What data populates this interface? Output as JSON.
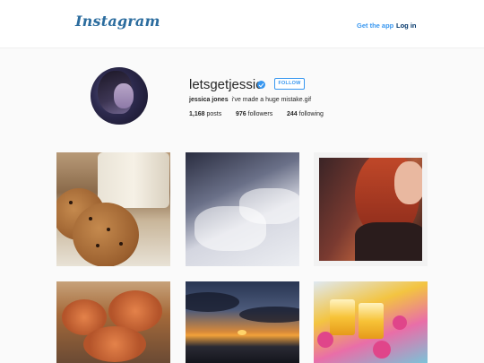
{
  "header": {
    "logo_text": "Instagram",
    "get_app_label": "Get the app",
    "log_in_label": "Log in"
  },
  "profile": {
    "username": "letsgetjessie",
    "verified": true,
    "follow_label": "FOLLOW",
    "full_name": "jessica jones",
    "bio": "i've made a huge mistake.gif",
    "stats": {
      "posts_count": "1,168",
      "posts_label": "posts",
      "followers_count": "976",
      "followers_label": "followers",
      "following_count": "244",
      "following_label": "following"
    }
  },
  "colors": {
    "accent": "#3897f0",
    "logo": "#2b6c9e",
    "text": "#262626",
    "background": "#fafafa"
  },
  "posts": [
    {
      "subject": "cookies-and-milk"
    },
    {
      "subject": "bedsheets"
    },
    {
      "subject": "redhead-selfie"
    },
    {
      "subject": "crab-dish"
    },
    {
      "subject": "ocean-sunset"
    },
    {
      "subject": "tropical-drinks"
    }
  ]
}
